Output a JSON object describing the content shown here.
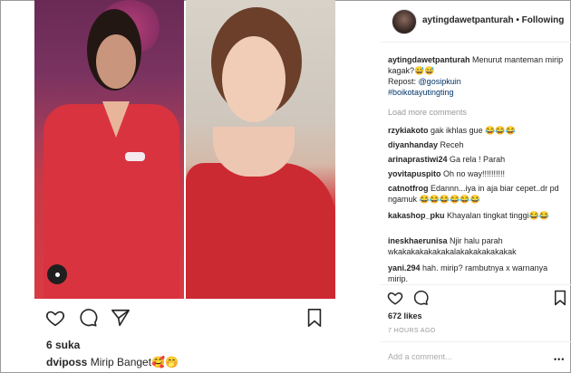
{
  "left_post": {
    "likes": "6 suka",
    "caption_user": "dviposs",
    "caption_text": "Mirip Banget",
    "caption_emoji": "🥰🤭"
  },
  "right_post": {
    "username": "aytingdawetpanturah",
    "follow_sep": "•",
    "follow_label": "Following",
    "caption_user": "aytingdawetpanturah",
    "caption_text": "Menurut manteman mirip kagak?😅😅",
    "repost": "Repost:",
    "repost_handle": "@gosipkuin",
    "hashtag": "#boikotayutingting",
    "load_more": "Load more comments",
    "comments": [
      {
        "user": "rzykiakoto",
        "text": "gak ikhlas gue 😂😂😂"
      },
      {
        "user": "diyanhanday",
        "text": "Receh"
      },
      {
        "user": "arinaprastiwi24",
        "text": "Ga rela ! Parah"
      },
      {
        "user": "yovitapuspito",
        "text": "Oh no way!!!!!!!!!!"
      },
      {
        "user": "catnotfrog",
        "text": "Edannn...iya in aja biar cepet..dr pd ngamuk 😂😂😂😂😂😂"
      },
      {
        "user": "kakashop_pku",
        "text": "Khayalan tingkat tinggi😂😂"
      },
      {
        "user": "ineskhaerunisa",
        "text": "Njir halu parah wkakakakakakakalakakakakakakak"
      },
      {
        "user": "yani.294",
        "text": "hah. mirip? rambutnya x warnanya mirip."
      }
    ],
    "likes": "672 likes",
    "time": "7 HOURS AGO",
    "add_comment": "Add a comment...",
    "more": "•••"
  }
}
